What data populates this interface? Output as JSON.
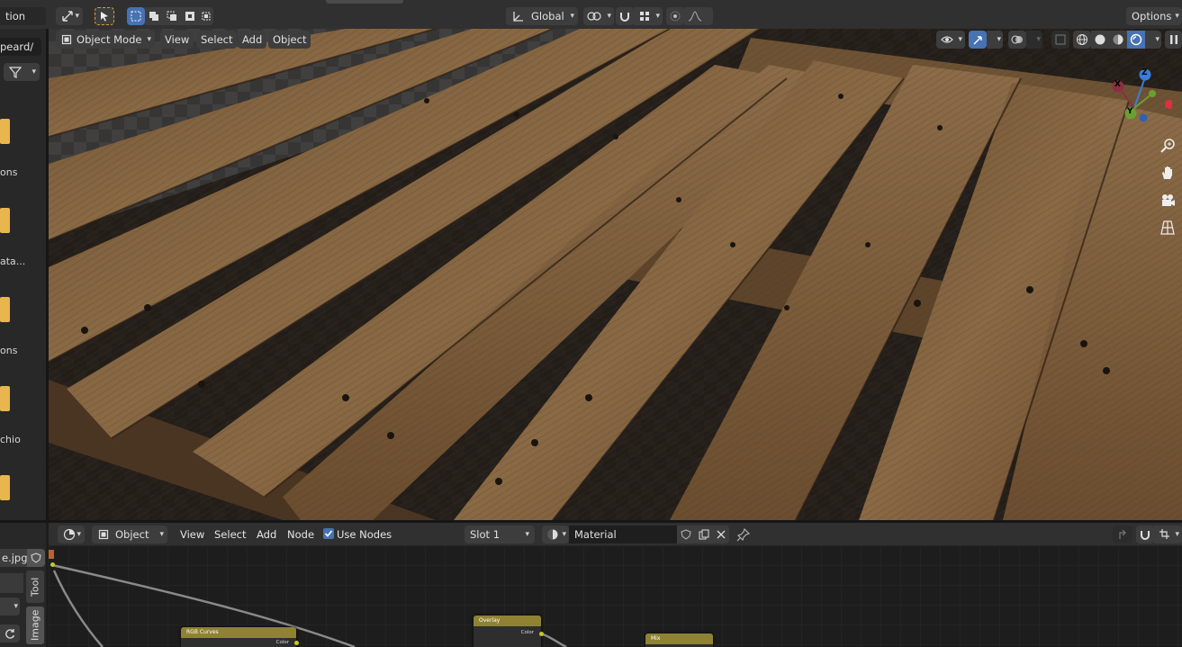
{
  "topbar": {
    "left_label": "tion",
    "orientation": "Global",
    "options": "Options"
  },
  "leftpanel": {
    "path": "peard/",
    "items": [
      "ons",
      "ata...",
      "ons",
      "chio"
    ]
  },
  "viewport": {
    "mode": "Object Mode",
    "menu": [
      "View",
      "Select",
      "Add",
      "Object"
    ],
    "gizmo": {
      "x": "X",
      "y": "Y",
      "z": "Z"
    }
  },
  "node_editor": {
    "object_type": "Object",
    "menu": [
      "View",
      "Select",
      "Add",
      "Node"
    ],
    "use_nodes": "Use Nodes",
    "slot": "Slot 1",
    "material": "Material",
    "image_name": "e.jpg",
    "tabs": [
      "Tool",
      "Image"
    ],
    "nodes": [
      {
        "title": "RGB Curves",
        "output": "Color"
      },
      {
        "title": "Overlay",
        "output": "Color"
      },
      {
        "title": "Mix"
      }
    ]
  },
  "colors": {
    "accent": "#4772b3",
    "folder": "#e8b64c",
    "node_header": "#8f8233",
    "socket": "#c7c729"
  }
}
